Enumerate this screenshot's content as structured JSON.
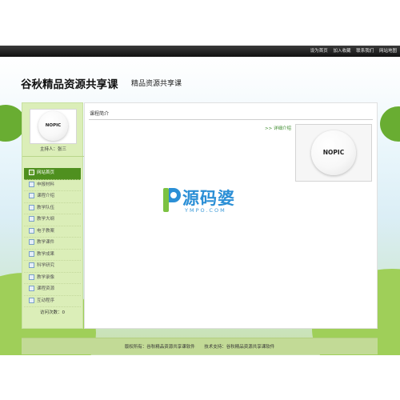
{
  "header": {
    "links": [
      "设为首页",
      "加入收藏",
      "联系我们",
      "网站地图"
    ],
    "site_title": "谷秋精品资源共享课",
    "site_subtitle": "精品资源共享课"
  },
  "sidebar": {
    "avatar_text": "NOPIC",
    "owner": "主持人：张三",
    "menu": [
      {
        "label": "网站首页",
        "active": true
      },
      {
        "label": "申报材料"
      },
      {
        "label": "课程介绍"
      },
      {
        "label": "教学队伍"
      },
      {
        "label": "教学大纲"
      },
      {
        "label": "电子教案"
      },
      {
        "label": "教学课件"
      },
      {
        "label": "教学成果"
      },
      {
        "label": "科学研究"
      },
      {
        "label": "教学录像"
      },
      {
        "label": "课程资源"
      },
      {
        "label": "互动程序"
      }
    ],
    "visits": "访问次数：0"
  },
  "content": {
    "heading": "课程简介",
    "detail_link": ">> 详细介绍",
    "photo_text": "NOPIC"
  },
  "watermark": {
    "main": "源码婆",
    "sub": "YMPO.COM",
    "logo_letter": "P"
  },
  "footer": {
    "copyright": "版权所有：谷秋精品资源共享课软件",
    "support": "技术支持：谷秋精品资源共享课软件"
  },
  "colors": {
    "topbar": "#1a1a1a",
    "menu_active": "#4f901f",
    "sidebar_bg": "#dbeeb8",
    "footer_bg": "#c2da96",
    "watermark_blue": "#2b8fd6",
    "watermark_green": "#7cc242"
  }
}
